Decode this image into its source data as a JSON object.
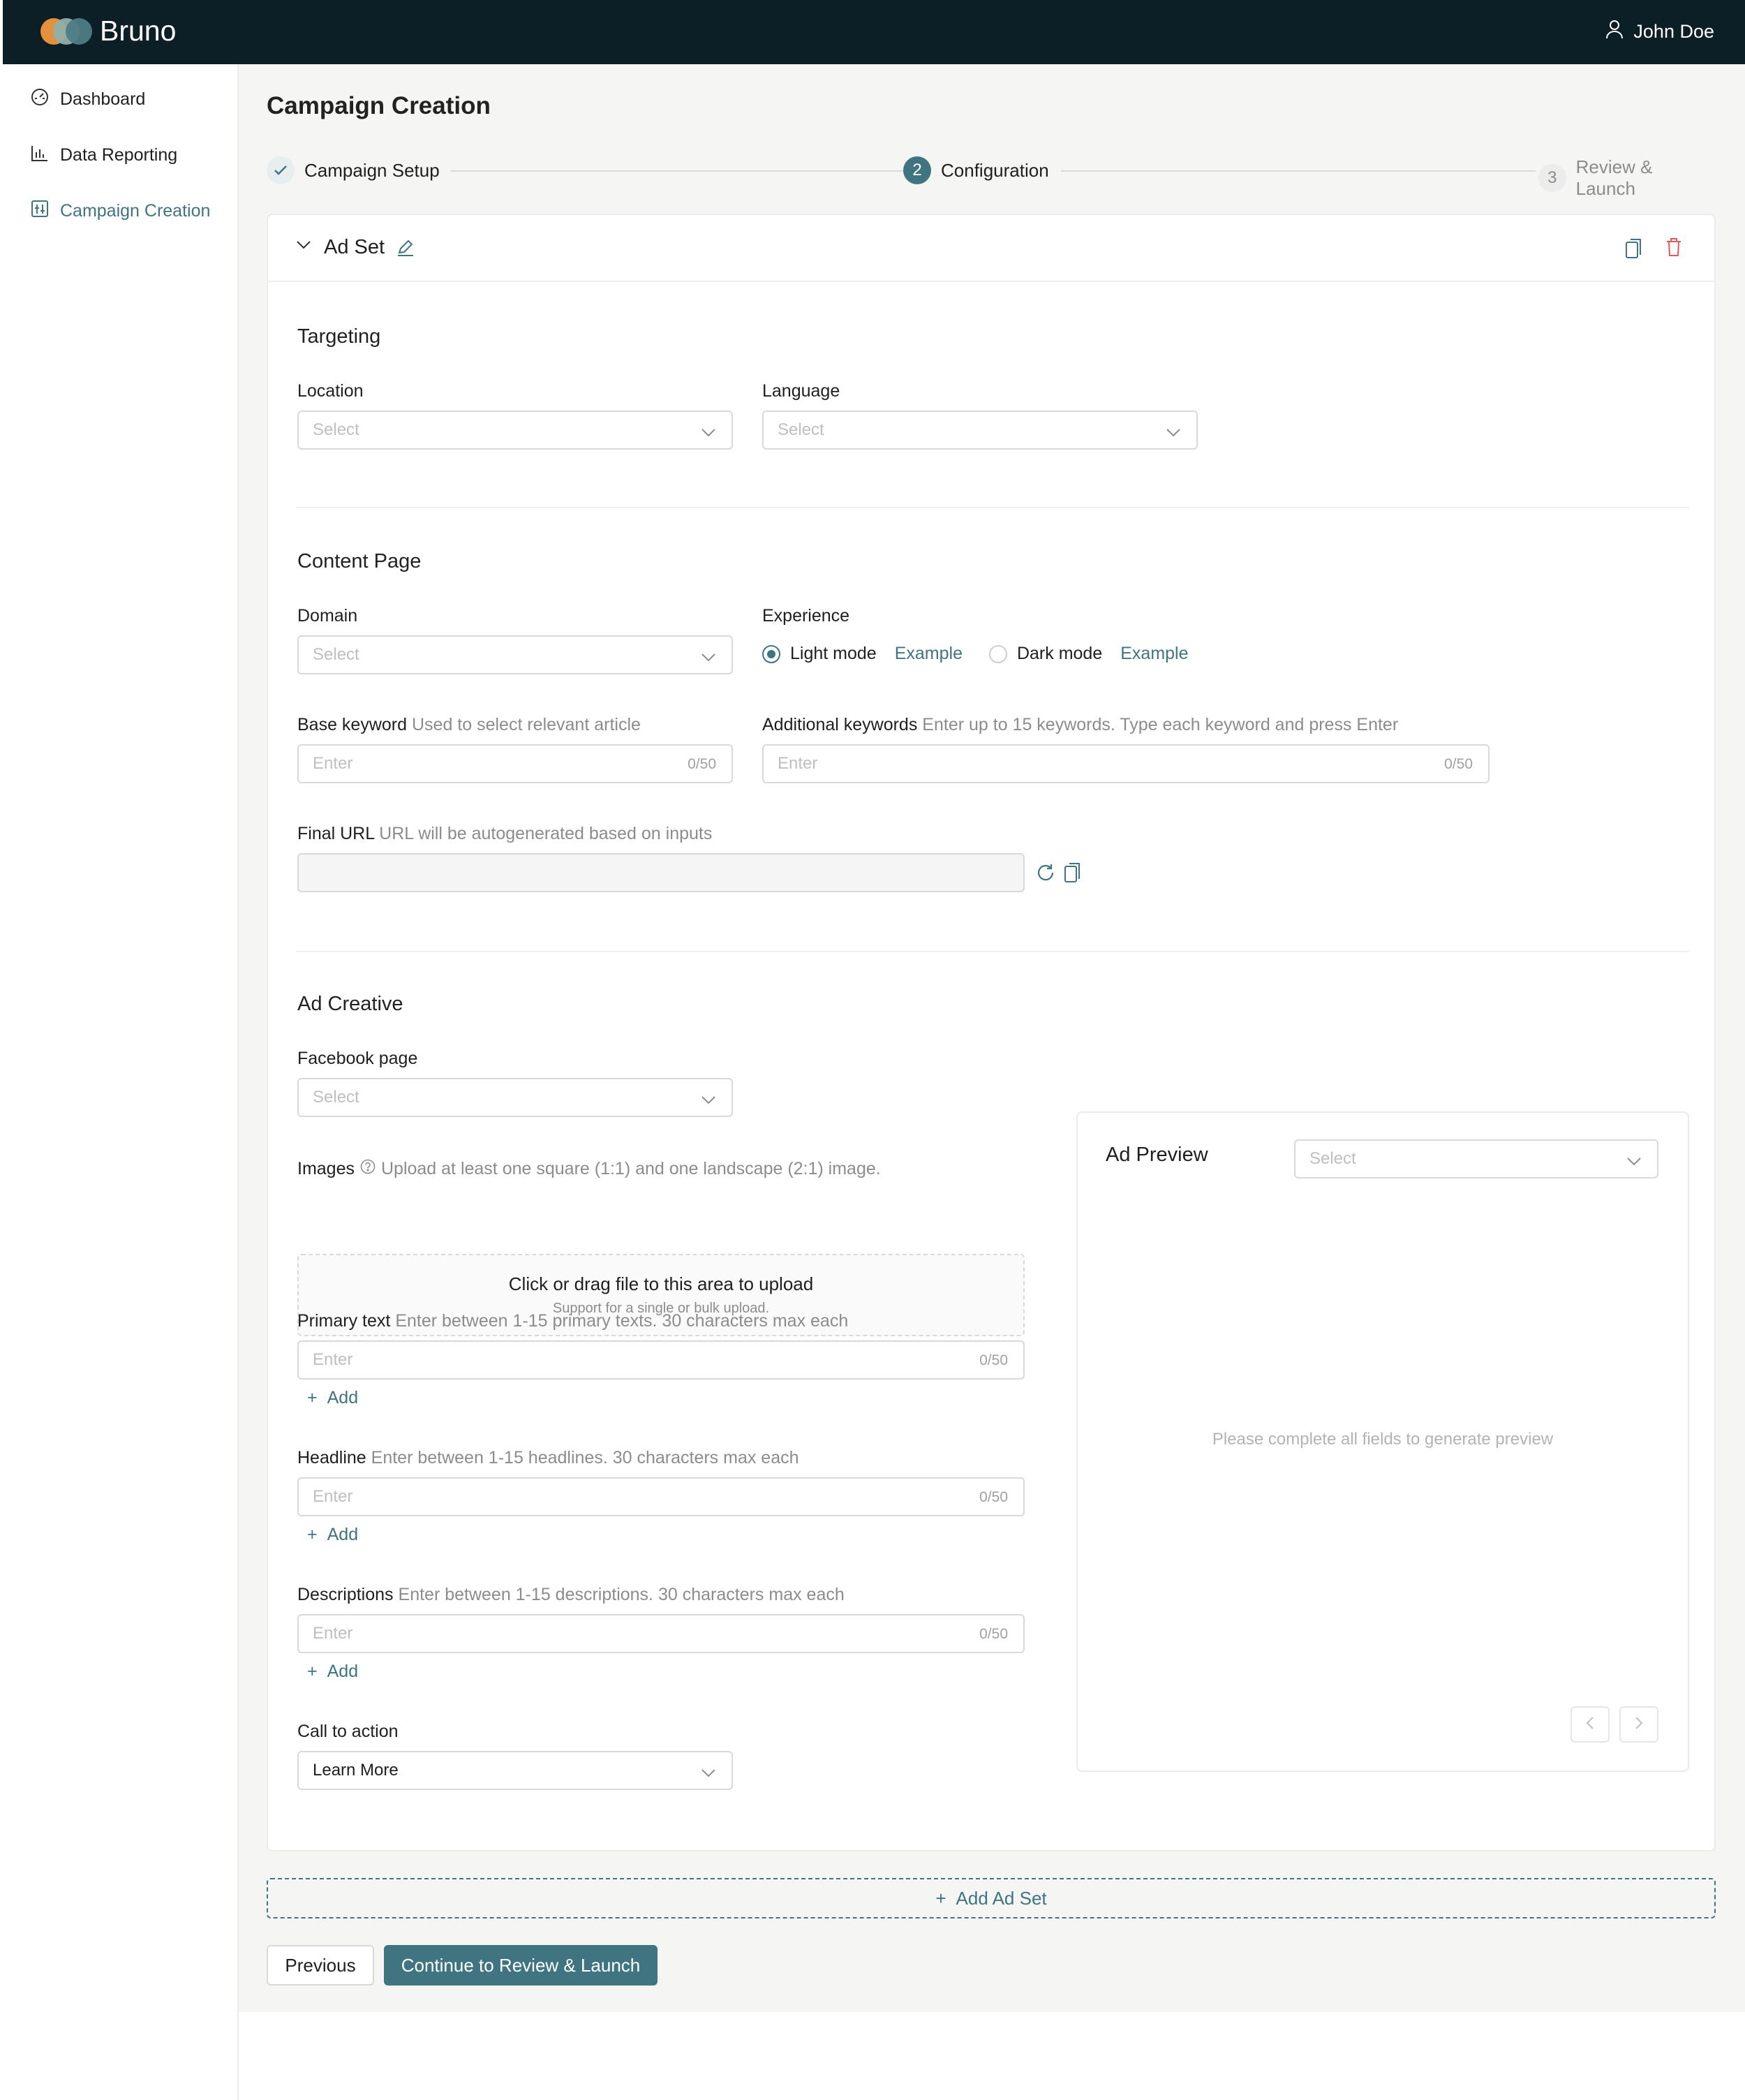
{
  "app": {
    "brand": "Bruno",
    "user_name": "John Doe",
    "colors": {
      "header_bg": "#0c1f26",
      "accent": "#3f7480",
      "danger": "#e05a5a",
      "logo": [
        "#e3913d",
        "#8fb0a8",
        "#4f7c86"
      ]
    }
  },
  "sidebar": {
    "items": [
      {
        "label": "Dashboard",
        "icon": "dashboard-icon"
      },
      {
        "label": "Data Reporting",
        "icon": "bar-chart-icon"
      },
      {
        "label": "Campaign Creation",
        "icon": "campaign-icon",
        "active": true
      }
    ]
  },
  "page": {
    "title": "Campaign Creation",
    "steps": [
      {
        "label": "Campaign Setup",
        "status": "done"
      },
      {
        "label": "Configuration",
        "number": "2",
        "status": "current"
      },
      {
        "label": "Review & Launch",
        "number": "3",
        "status": "pending"
      }
    ]
  },
  "adset": {
    "title": "Ad Set",
    "targeting": {
      "title": "Targeting",
      "location_label": "Location",
      "location_placeholder": "Select",
      "language_label": "Language",
      "language_placeholder": "Select"
    },
    "content": {
      "title": "Content Page",
      "domain_label": "Domain",
      "domain_placeholder": "Select",
      "experience_label": "Experience",
      "light_label": "Light mode",
      "dark_label": "Dark mode",
      "example_label": "Example",
      "selected_experience": "Light mode",
      "base_keyword_label": "Base keyword",
      "base_keyword_hint": "Used to select relevant article",
      "base_keyword_placeholder": "Enter",
      "base_keyword_count": "0/50",
      "additional_label": "Additional keywords",
      "additional_hint": "Enter up to 15 keywords. Type each keyword and press Enter",
      "additional_placeholder": "Enter",
      "additional_count": "0/50",
      "final_url_label": "Final URL",
      "final_url_hint": "URL will be autogenerated based on inputs",
      "final_url_value": ""
    },
    "creative": {
      "title": "Ad Creative",
      "facebook_label": "Facebook page",
      "facebook_placeholder": "Select",
      "images_label": "Images",
      "images_hint": "Upload at least one square (1:1) and one landscape (2:1) image.",
      "upload_title": "Click or drag file to this area to upload",
      "upload_sub": "Support for a single or bulk upload.",
      "primary_label": "Primary text",
      "primary_hint": "Enter between 1-15 primary texts. 30 characters max each",
      "primary_placeholder": "Enter",
      "primary_count": "0/50",
      "headline_label": "Headline",
      "headline_hint": "Enter between 1-15 headlines. 30 characters max each",
      "headline_placeholder": "Enter",
      "headline_count": "0/50",
      "desc_label": "Descriptions",
      "desc_hint": "Enter between 1-15 descriptions. 30 characters max each",
      "desc_placeholder": "Enter",
      "desc_count": "0/50",
      "add_label": "Add",
      "cta_label": "Call to action",
      "cta_value": "Learn More"
    },
    "preview": {
      "title": "Ad Preview",
      "select_placeholder": "Select",
      "empty_message": "Please complete all fields to generate preview"
    }
  },
  "footer": {
    "add_adset_label": "Add Ad Set",
    "previous_label": "Previous",
    "continue_label": "Continue to Review & Launch"
  }
}
